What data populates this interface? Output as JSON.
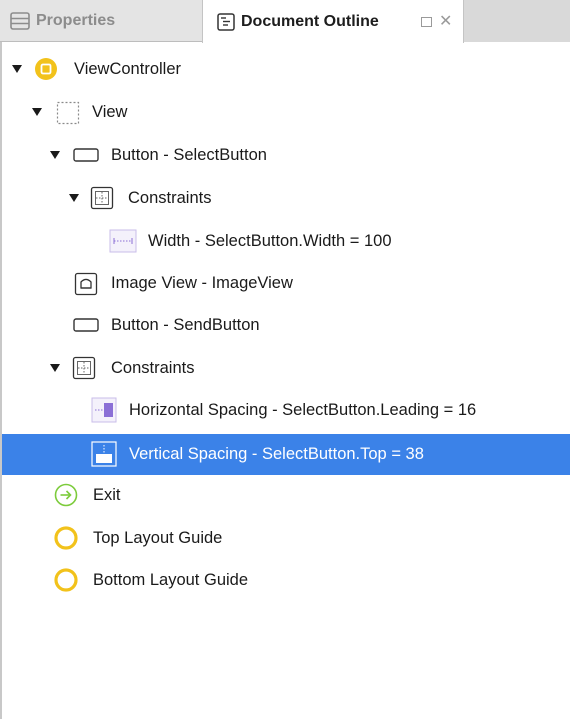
{
  "tabs": {
    "properties": "Properties",
    "document_outline": "Document Outline"
  },
  "outline": [
    {
      "label": "ViewController",
      "icon": "viewcontroller-icon"
    },
    {
      "label": "View",
      "icon": "view-icon"
    },
    {
      "label": "Button - SelectButton",
      "icon": "button-icon"
    },
    {
      "label": "Constraints",
      "icon": "constraints-icon"
    },
    {
      "label": "Width - SelectButton.Width = 100",
      "icon": "width-constraint-icon"
    },
    {
      "label": "Image View - ImageView",
      "icon": "imageview-icon"
    },
    {
      "label": "Button - SendButton",
      "icon": "button-icon"
    },
    {
      "label": "Constraints",
      "icon": "constraints-icon"
    },
    {
      "label": "Horizontal Spacing - SelectButton.Leading = 16",
      "icon": "horizontal-spacing-icon"
    },
    {
      "label": "Vertical Spacing - SelectButton.Top = 38",
      "icon": "vertical-spacing-icon",
      "selected": true
    },
    {
      "label": "Exit",
      "icon": "exit-icon"
    },
    {
      "label": "Top Layout Guide",
      "icon": "layout-guide-icon"
    },
    {
      "label": "Bottom Layout Guide",
      "icon": "layout-guide-icon"
    }
  ],
  "colors": {
    "selection": "#3b82e8",
    "viewcontroller_icon": "#f2c21b",
    "exit_icon": "#7ccb3b",
    "layout_guide_icon": "#f2c21b",
    "constraint_icon": "#8b6fd6"
  }
}
